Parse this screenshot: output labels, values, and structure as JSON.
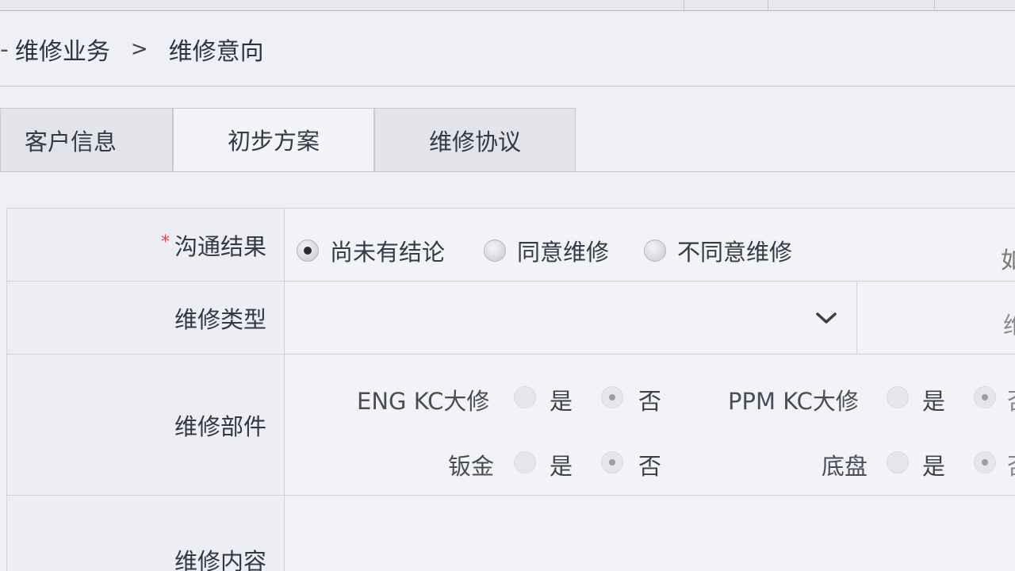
{
  "breadcrumb": {
    "prefix": "-",
    "section": "维修业务",
    "separator": ">",
    "current": "维修意向"
  },
  "tabs": [
    {
      "label": "客户信息"
    },
    {
      "label": "初步方案"
    },
    {
      "label": "维修协议"
    }
  ],
  "form": {
    "communication_result": {
      "label": "沟通结果",
      "required_mark": "*",
      "options": [
        "尚未有结论",
        "同意维修",
        "不同意维修"
      ],
      "selected": "尚未有结论",
      "cut_off_right": "如"
    },
    "repair_type": {
      "label": "维修类型",
      "value": "",
      "cut_off_right": "维"
    },
    "repair_parts": {
      "label": "维修部件",
      "items": [
        {
          "name": "ENG KC大修",
          "selected": "否"
        },
        {
          "name": "PPM KC大修",
          "selected": "否"
        },
        {
          "name": "钣金",
          "selected": "否"
        },
        {
          "name": "底盘",
          "selected": "否"
        }
      ],
      "yes_label": "是",
      "no_label": "否",
      "cut_off_no": "否"
    },
    "repair_content": {
      "label": "维修内容"
    }
  },
  "icons": {
    "dropdown": "chevron-down-icon"
  },
  "colors": {
    "required": "#dd4444",
    "background": "#eef0f6",
    "radio_checked": "#2b2d36"
  }
}
